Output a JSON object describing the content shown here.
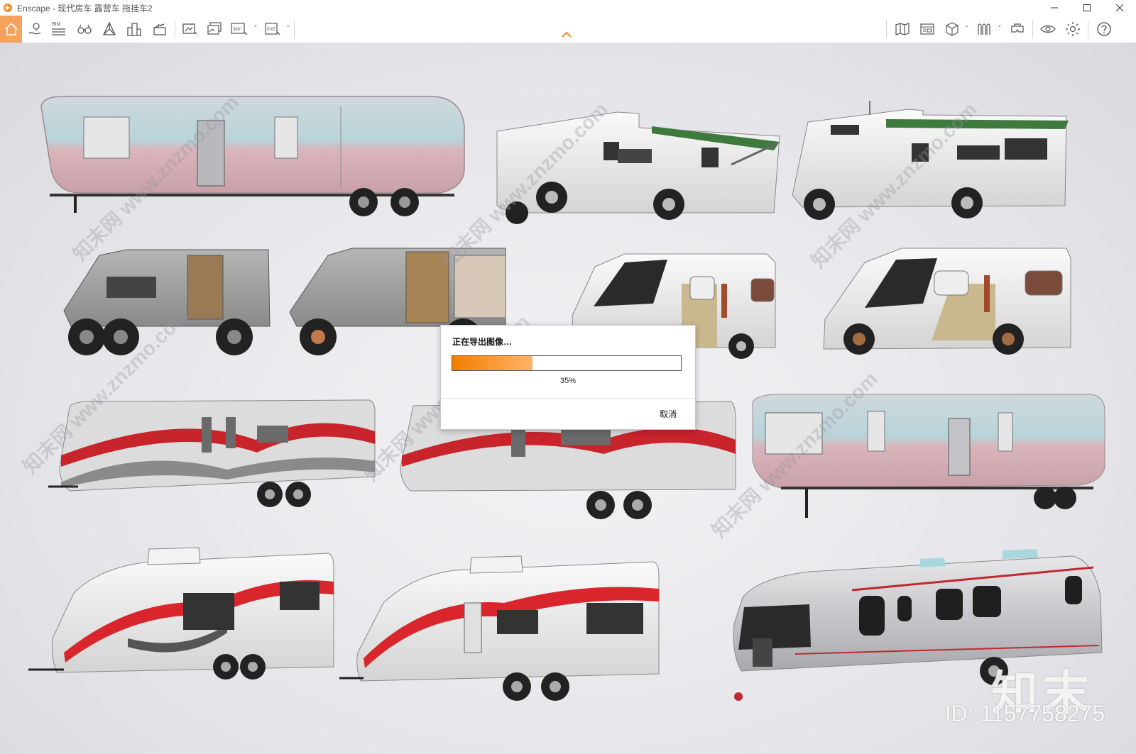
{
  "window": {
    "title": "Enscape - 现代房车 露营车 拖挂车2",
    "accent_color": "#f5a25d"
  },
  "toolbar": {
    "bim_label": "BIM",
    "panorama_label": "360°",
    "exe_label": "EXE",
    "left_icons": [
      "home-icon",
      "location-pin-icon",
      "bim-icon",
      "binoculars-icon",
      "perspective-icon",
      "buildings-icon",
      "clapperboard-icon",
      "screenshot-icon",
      "batch-render-icon",
      "panorama-icon",
      "exe-export-icon"
    ],
    "right_icons": [
      "map-icon",
      "asset-library-icon",
      "cube-icon",
      "materials-icon",
      "vr-headset-icon",
      "eye-icon",
      "settings-icon",
      "help-icon"
    ]
  },
  "dialog": {
    "title": "正在导出图像…",
    "progress": 0.35,
    "percent_label": "35%",
    "cancel_label": "取消"
  },
  "watermark": {
    "brand": "知末",
    "id_text": "ID: 1157758275",
    "repeat_text": "知末网 www.znzmo.com"
  }
}
